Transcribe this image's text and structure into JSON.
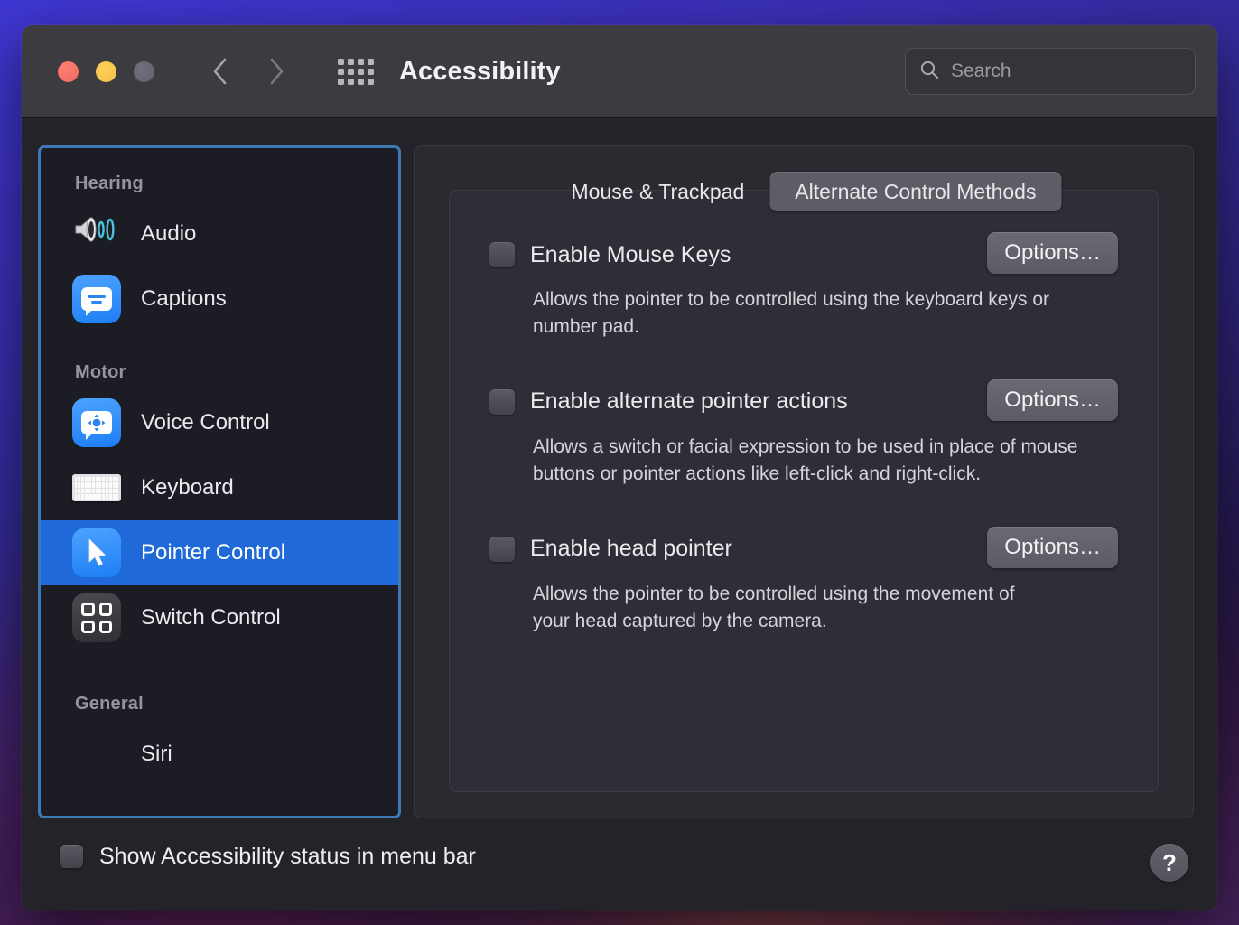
{
  "window": {
    "title": "Accessibility",
    "traffic_lights": [
      "close-button",
      "minimize-button",
      "zoom-button"
    ],
    "nav": {
      "back": "back-button",
      "forward": "forward-button"
    },
    "grid_button": "show-all-button"
  },
  "search": {
    "placeholder": "Search",
    "value": "",
    "icon": "search-icon"
  },
  "sidebar": {
    "groups": [
      {
        "header": "Hearing",
        "items": [
          {
            "label": "Audio",
            "icon": "speaker-icon",
            "selected": false
          },
          {
            "label": "Captions",
            "icon": "captions-icon",
            "selected": false
          }
        ]
      },
      {
        "header": "Motor",
        "items": [
          {
            "label": "Voice Control",
            "icon": "voice-control-icon",
            "selected": false
          },
          {
            "label": "Keyboard",
            "icon": "keyboard-icon",
            "selected": false
          },
          {
            "label": "Pointer Control",
            "icon": "pointer-icon",
            "selected": true
          },
          {
            "label": "Switch Control",
            "icon": "switch-control-icon",
            "selected": false
          }
        ]
      },
      {
        "header": "General",
        "items": [
          {
            "label": "Siri",
            "icon": "siri-icon",
            "selected": false
          }
        ]
      }
    ]
  },
  "main": {
    "tabs": [
      {
        "label": "Mouse & Trackpad",
        "active": false
      },
      {
        "label": "Alternate Control Methods",
        "active": true
      }
    ],
    "options": [
      {
        "title": "Enable Mouse Keys",
        "checked": false,
        "button": "Options…",
        "description": "Allows the pointer to be controlled using the keyboard keys or number pad."
      },
      {
        "title": "Enable alternate pointer actions",
        "checked": false,
        "button": "Options…",
        "description": "Allows a switch or facial expression to be used in place of mouse buttons or pointer actions like left-click and right-click."
      },
      {
        "title": "Enable head pointer",
        "checked": false,
        "button": "Options…",
        "description": "Allows the pointer to be controlled using the movement of your head captured by the camera."
      }
    ]
  },
  "footer": {
    "checkbox_label": "Show Accessibility status in menu bar",
    "checked": false,
    "help_label": "?"
  },
  "colors": {
    "accent_selection": "#2069d8",
    "focus_ring": "#3e79b4",
    "window_bg": "#232329",
    "sidebar_bg": "#1c1c24",
    "panel_bg": "#2a2a31",
    "tab_active_bg": "#5d5d65"
  }
}
